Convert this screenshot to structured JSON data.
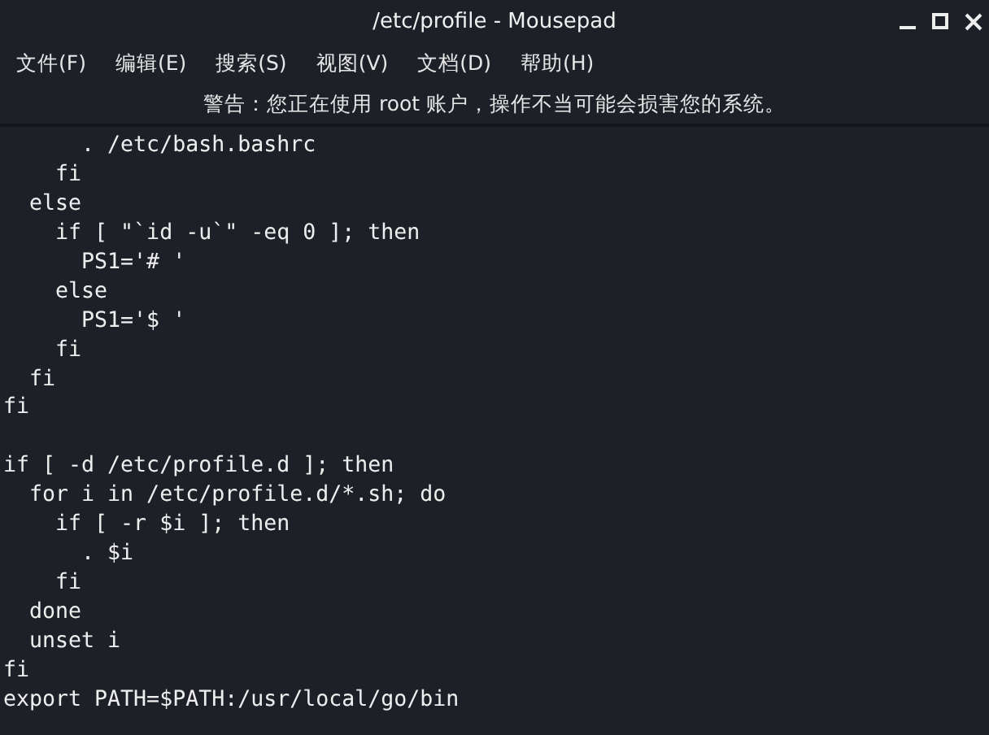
{
  "window": {
    "title": "/etc/profile - Mousepad"
  },
  "menu": [
    {
      "label": "文件(F)"
    },
    {
      "label": "编辑(E)"
    },
    {
      "label": "搜索(S)"
    },
    {
      "label": "视图(V)"
    },
    {
      "label": "文档(D)"
    },
    {
      "label": "帮助(H)"
    }
  ],
  "warning": "警告：您正在使用 root 账户，操作不当可能会损害您的系统。",
  "editor": {
    "blocks": [
      [
        "      . /etc/bash.bashrc",
        "    fi",
        "  else",
        "    if [ \"`id -u`\" -eq 0 ]; then",
        "      PS1='# '",
        "    else",
        "      PS1='$ '",
        "    fi",
        "  fi",
        "fi"
      ],
      [
        "if [ -d /etc/profile.d ]; then",
        "  for i in /etc/profile.d/*.sh; do",
        "    if [ -r $i ]; then",
        "      . $i",
        "    fi",
        "  done",
        "  unset i",
        "fi",
        "export PATH=$PATH:/usr/local/go/bin"
      ]
    ]
  }
}
